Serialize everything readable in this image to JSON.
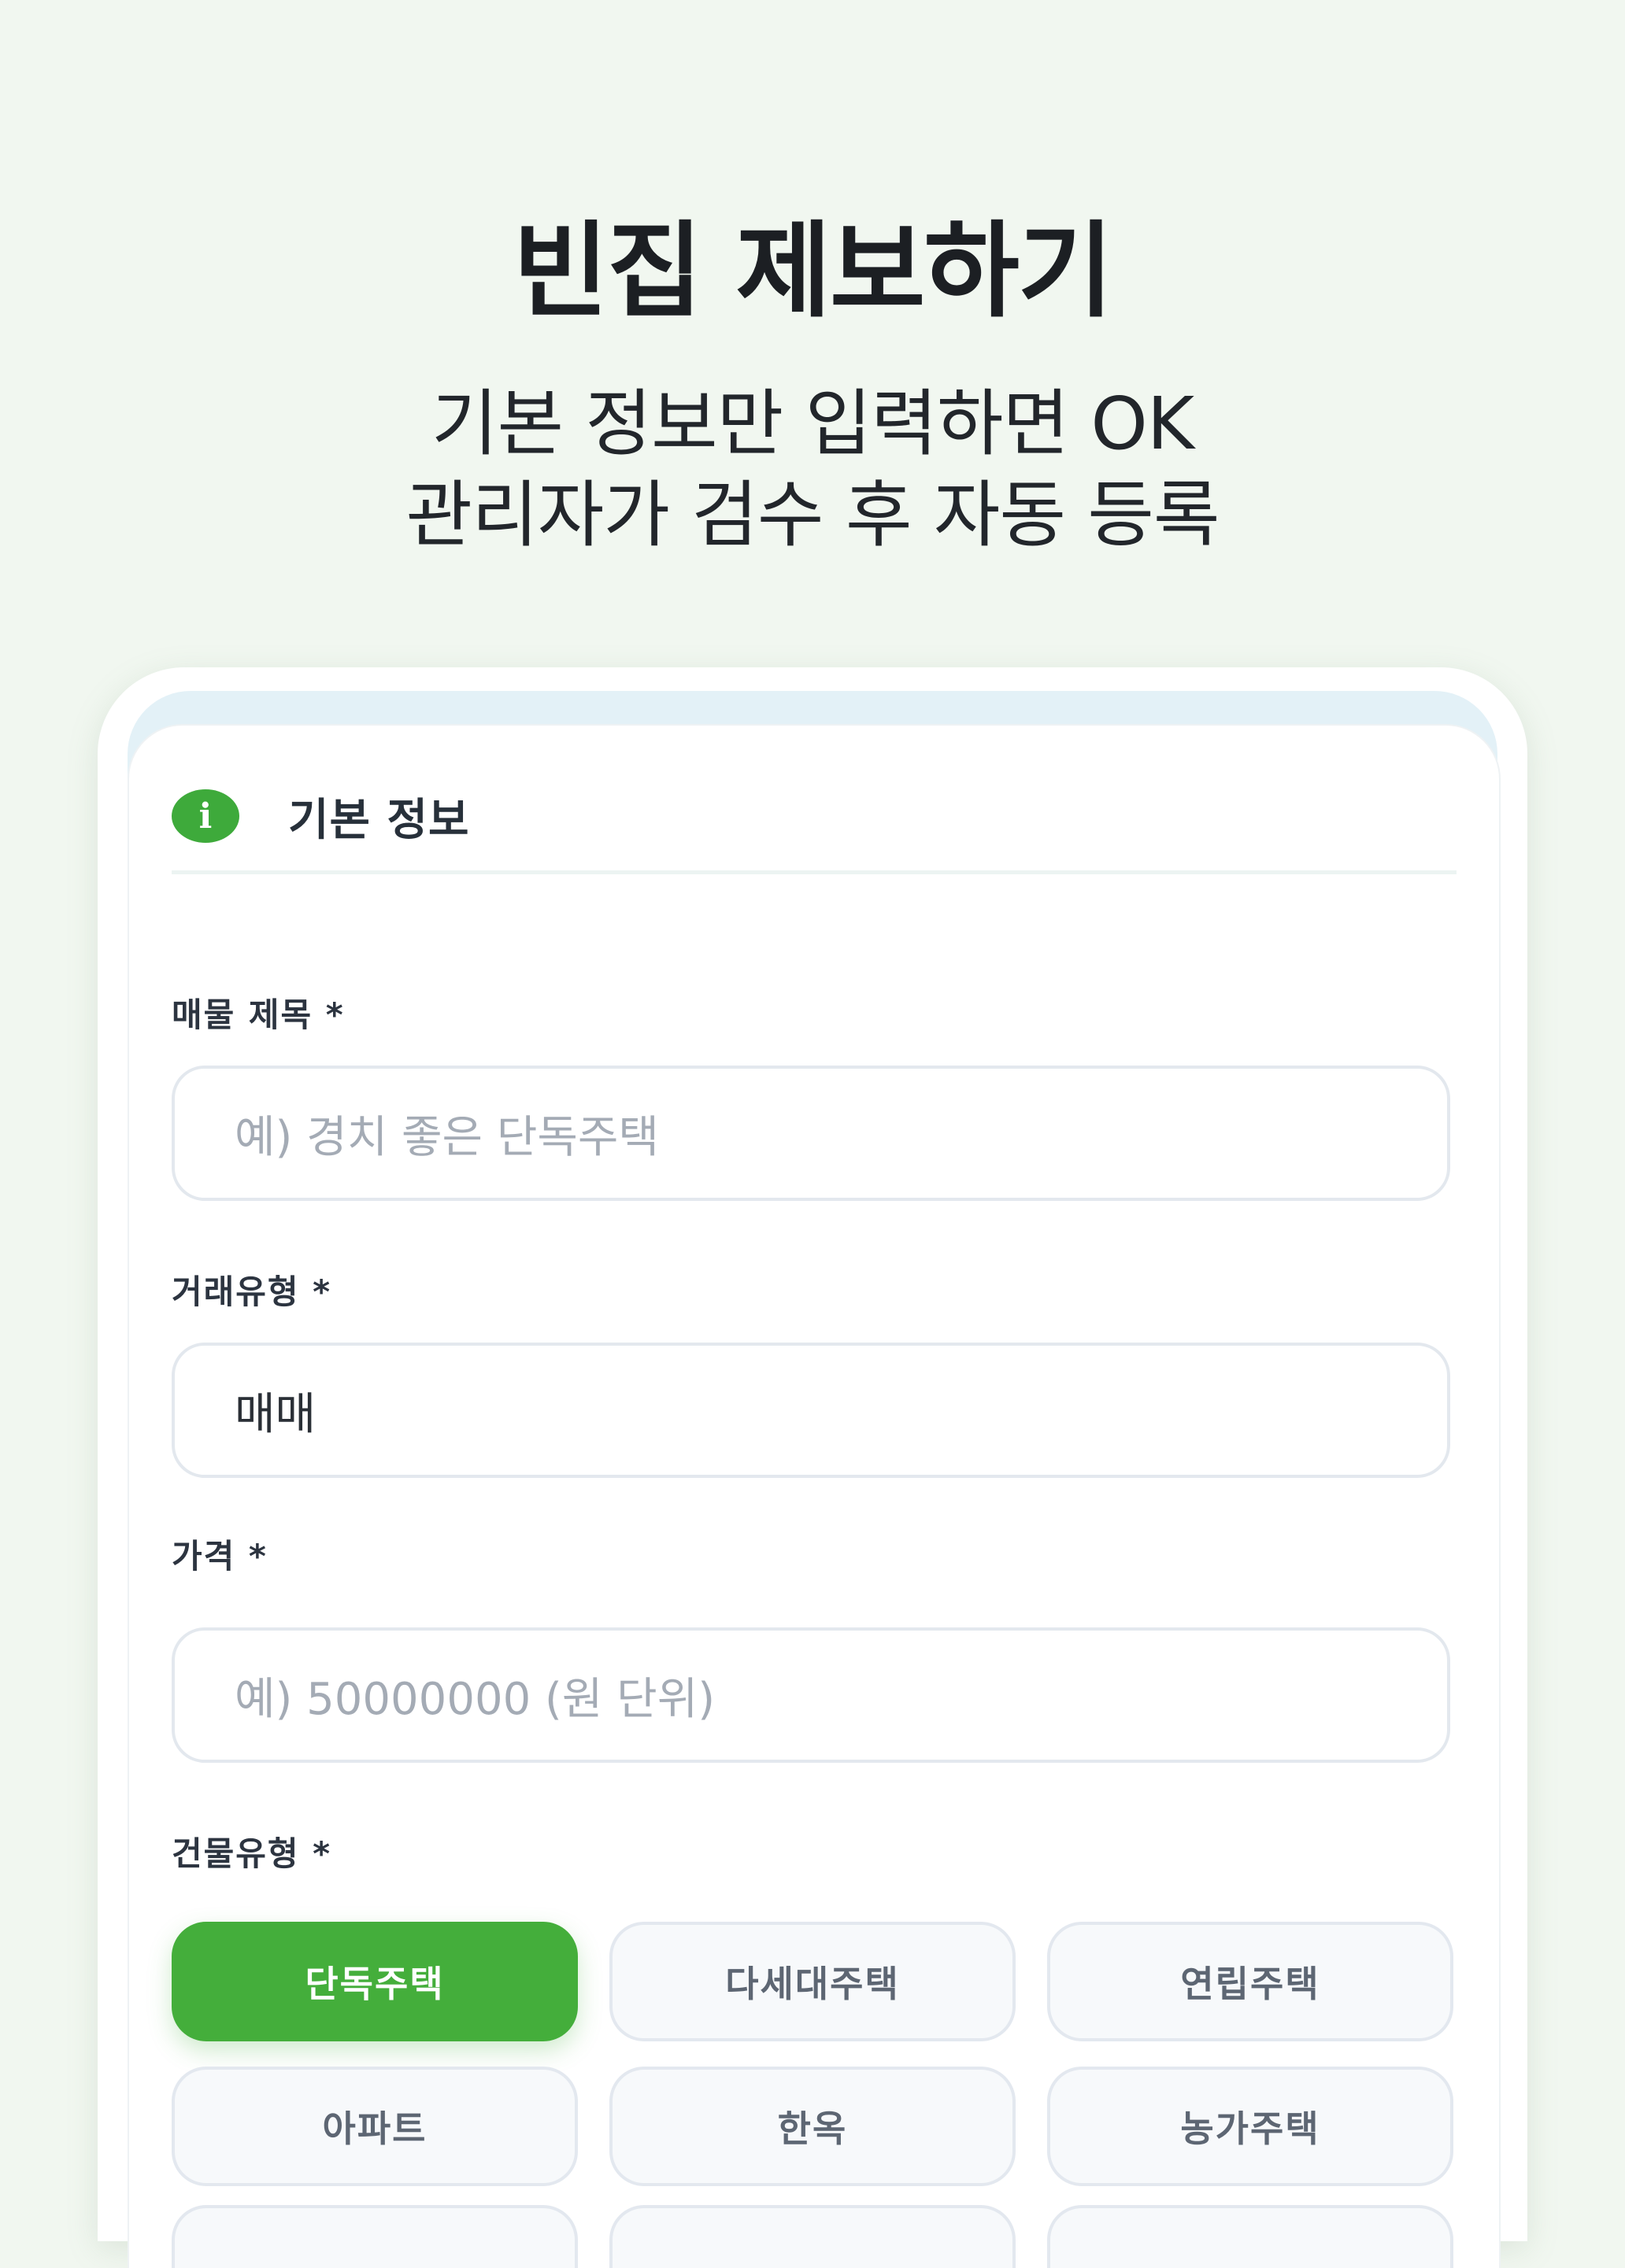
{
  "hero": {
    "title": "빈집 제보하기",
    "subtitle_line1": "기본 정보만 입력하면 OK",
    "subtitle_line2": "관리자가 검수 후 자동 등록"
  },
  "section": {
    "icon": "info-icon",
    "icon_glyph": "i",
    "title": "기본 정보"
  },
  "fields": {
    "title": {
      "label": "매물 제목 *",
      "placeholder": "예) 경치 좋은 단독주택"
    },
    "deal_type": {
      "label": "거래유형 *",
      "value": "매매"
    },
    "price": {
      "label": "가격 *",
      "placeholder": "예) 50000000 (원 단위)"
    },
    "building_type": {
      "label": "건물유형 *",
      "options": [
        "단독주택",
        "다세대주택",
        "연립주택",
        "아파트",
        "한옥",
        "농가주택"
      ],
      "selected": "단독주택"
    }
  },
  "colors": {
    "accent": "#44ae3b",
    "background": "#f1f7f0"
  }
}
